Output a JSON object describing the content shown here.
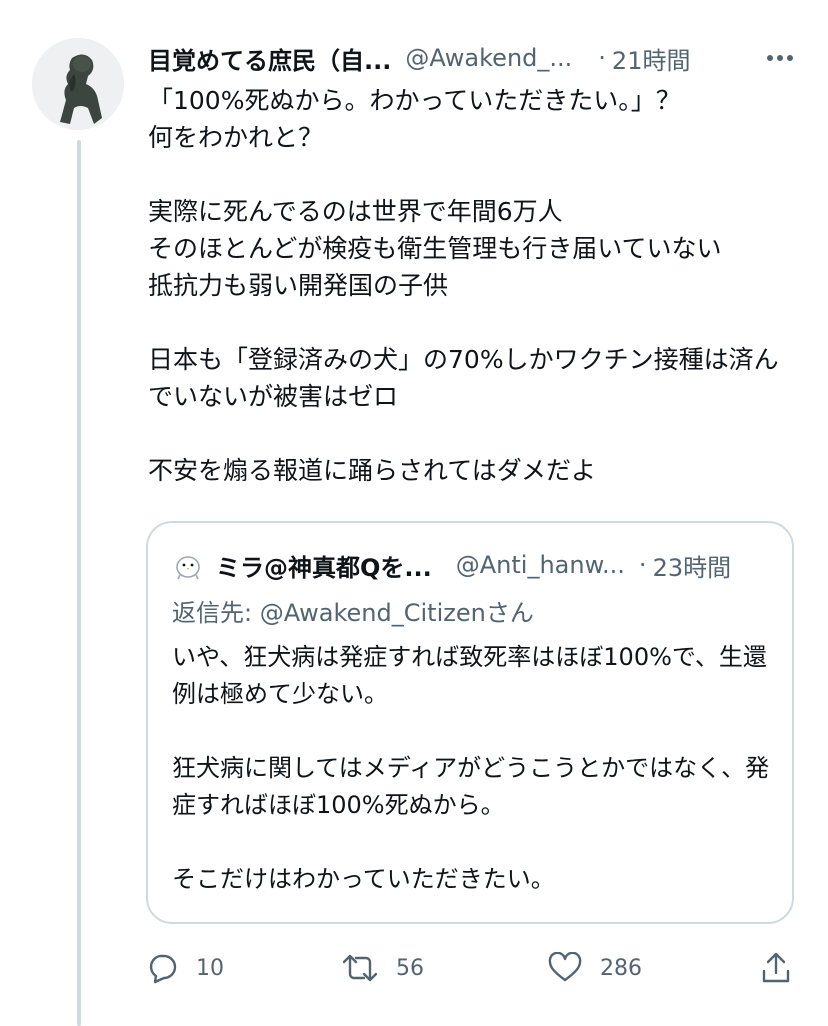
{
  "tweet": {
    "display_name": "目覚めてる庶民（自...",
    "handle": "@Awakend_...",
    "separator": "·",
    "time": "21時間",
    "text": "「100%死ぬから。わかっていただきたい。」？\n何をわかれと？\n\n実際に死んでるのは世界で年間6万人\nそのほとんどが検疫も衛生管理も行き届いていない\n抵抗力も弱い開発国の子供\n\n日本も「登録済みの犬」の70%しかワクチン接種は済んでいないが被害はゼロ\n\n不安を煽る報道に踊らされてはダメだよ",
    "avatar_icon": "thinker-statue-avatar",
    "more_icon": "more-horizontal-icon"
  },
  "quoted": {
    "display_name": "ミラ@神真都Qを...",
    "handle": "@Anti_hanw...",
    "separator": "·",
    "time": "23時間",
    "reply_to": "返信先: @Awakend_Citizenさん",
    "text": "いや、狂犬病は発症すれば致死率はほぼ100%で、生還例は極めて少ない。\n\n狂犬病に関してはメディアがどうこうとかではなく、発症すればほぼ100%死ぬから。\n\nそこだけはわかっていただきたい。",
    "avatar_icon": "bird-avatar"
  },
  "actions": {
    "replies": "10",
    "retweets": "56",
    "likes": "286",
    "reply_icon": "reply-bubble-icon",
    "retweet_icon": "retweet-icon",
    "like_icon": "heart-icon",
    "share_icon": "share-icon"
  },
  "colors": {
    "text": "#0f1419",
    "secondary": "#536471",
    "border": "#cfd9de",
    "background": "#ffffff"
  }
}
